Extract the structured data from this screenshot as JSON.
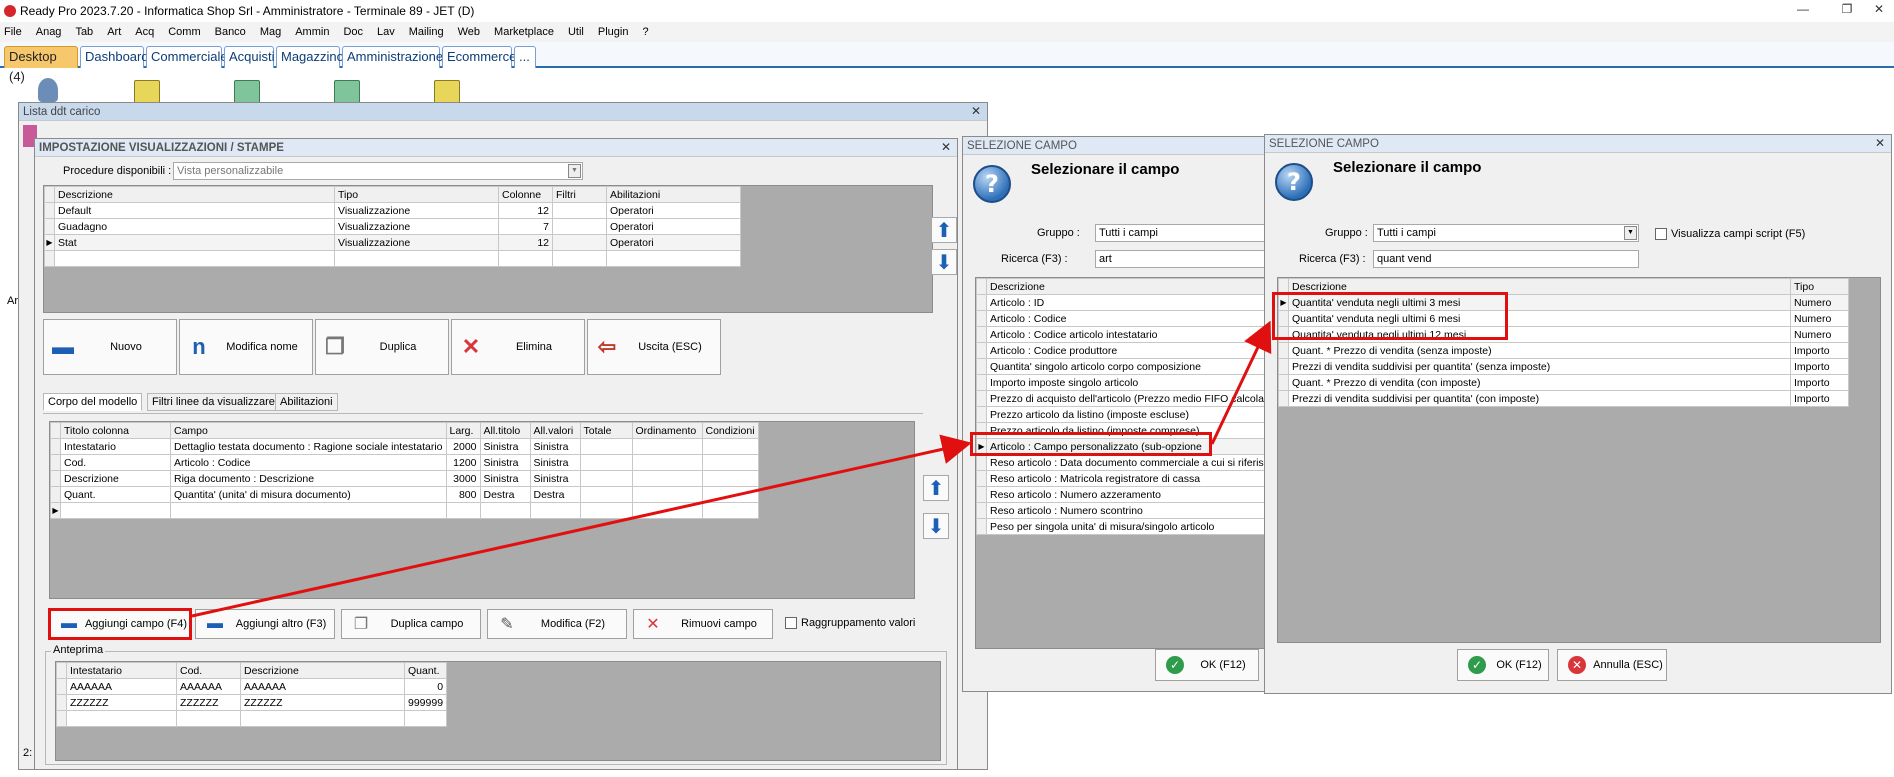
{
  "app": {
    "title": "Ready Pro 2023.7.20 - Informatica Shop Srl - Amministratore - Terminale 89 - JET (D)"
  },
  "menu": [
    "File",
    "Anag",
    "Tab",
    "Art",
    "Acq",
    "Comm",
    "Banco",
    "Mag",
    "Ammin",
    "Doc",
    "Lav",
    "Mailing",
    "Web",
    "Marketplace",
    "Util",
    "Plugin",
    "?"
  ],
  "tabs": [
    "Desktop (4)",
    "Dashboard",
    "Commerciale",
    "Acquisti",
    "Magazzino",
    "Amministrazione",
    "Ecommerce",
    "..."
  ],
  "lista": {
    "title": "Lista ddt carico",
    "left_label": "Ar",
    "bottom_label": "2:"
  },
  "imp": {
    "title": "IMPOSTAZIONE VISUALIZZAZIONI / STAMPE",
    "procedure_label": "Procedure disponibili :",
    "procedure_value": "Vista personalizzabile",
    "views_headers": [
      "Descrizione",
      "Tipo",
      "Colonne",
      "Filtri",
      "Abilitazioni"
    ],
    "views": [
      [
        "Default",
        "Visualizzazione",
        "12",
        "",
        "Operatori"
      ],
      [
        "Guadagno",
        "Visualizzazione",
        "7",
        "",
        "Operatori"
      ],
      [
        "Stat",
        "Visualizzazione",
        "12",
        "",
        "Operatori"
      ]
    ],
    "buttons": [
      "Nuovo",
      "Modifica nome",
      "Duplica",
      "Elimina",
      "Uscita (ESC)"
    ],
    "subtabs": [
      "Corpo del modello",
      "Filtri linee da visualizzare",
      "Abilitazioni"
    ],
    "cols_headers": [
      "Titolo colonna",
      "Campo",
      "Larg.",
      "All.titolo",
      "All.valori",
      "Totale",
      "Ordinamento",
      "Condizioni"
    ],
    "cols": [
      [
        "Intestatario",
        "Dettaglio testata documento : Ragione sociale intestatario",
        "2000",
        "Sinistra",
        "Sinistra",
        "",
        "",
        ""
      ],
      [
        "Cod.",
        "Articolo : Codice",
        "1200",
        "Sinistra",
        "Sinistra",
        "",
        "",
        ""
      ],
      [
        "Descrizione",
        "Riga documento : Descrizione",
        "3000",
        "Sinistra",
        "Sinistra",
        "",
        "",
        ""
      ],
      [
        "Quant.",
        "Quantita' (unita' di misura documento)",
        "800",
        "Destra",
        "Destra",
        "",
        "",
        ""
      ]
    ],
    "field_buttons": [
      "Aggiungi campo (F4)",
      "Aggiungi altro (F3)",
      "Duplica campo",
      "Modifica (F2)",
      "Rimuovi campo"
    ],
    "raggruppamento": "Raggruppamento valori",
    "anteprima_label": "Anteprima",
    "preview_headers": [
      "Intestatario",
      "Cod.",
      "Descrizione",
      "Quant."
    ],
    "preview": [
      [
        "AAAAAA",
        "AAAAAA",
        "AAAAAA",
        "0"
      ],
      [
        "ZZZZZZ",
        "ZZZZZZ",
        "ZZZZZZ",
        "999999"
      ]
    ]
  },
  "sel1": {
    "title": "SELEZIONE CAMPO",
    "heading": "Selezionare il campo",
    "gruppo_label": "Gruppo :",
    "gruppo_value": "Tutti i campi",
    "ricerca_label": "Ricerca (F3) :",
    "ricerca_value": "art",
    "header": "Descrizione",
    "rows": [
      "Articolo : ID",
      "Articolo : Codice",
      "Articolo : Codice articolo intestatario",
      "Articolo : Codice produttore",
      "Quantita' singolo articolo corpo composizione",
      "Importo imposte singolo articolo",
      "Prezzo di acquisto dell'articolo (Prezzo medio FIFO calcola",
      "Prezzo articolo da listino (imposte escluse)",
      "Prezzo articolo da listino (imposte comprese)",
      "Articolo : Campo personalizzato (sub-opzione",
      "Reso articolo : Data documento commerciale a cui si riferis",
      "Reso articolo : Matricola registratore di cassa",
      "Reso articolo : Numero azzeramento",
      "Reso articolo : Numero scontrino",
      "Peso per singola unita' di misura/singolo articolo"
    ],
    "ok": "OK (F12)"
  },
  "sel2": {
    "title": "SELEZIONE CAMPO",
    "heading": "Selezionare il campo",
    "gruppo_label": "Gruppo :",
    "gruppo_value": "Tutti i campi",
    "script_label": "Visualizza campi script (F5)",
    "ricerca_label": "Ricerca (F3) :",
    "ricerca_value": "quant vend",
    "headers": [
      "Descrizione",
      "Tipo"
    ],
    "rows": [
      [
        "Quantita' venduta negli ultimi 3 mesi",
        "Numero"
      ],
      [
        "Quantita' venduta negli ultimi 6 mesi",
        "Numero"
      ],
      [
        "Quantita' venduta negli ultimi 12 mesi",
        "Numero"
      ],
      [
        "Quant. * Prezzo di vendita (senza imposte)",
        "Importo"
      ],
      [
        "Prezzi di vendita suddivisi per quantita' (senza imposte)",
        "Importo"
      ],
      [
        "Quant. * Prezzo di vendita (con imposte)",
        "Importo"
      ],
      [
        "Prezzi di vendita suddivisi per quantita' (con imposte)",
        "Importo"
      ]
    ],
    "ok": "OK (F12)",
    "cancel": "Annulla (ESC)"
  },
  "colors": {
    "annotation": "#e01010",
    "tab_active": "#f7c86b",
    "tab_text": "#0c3d78"
  }
}
